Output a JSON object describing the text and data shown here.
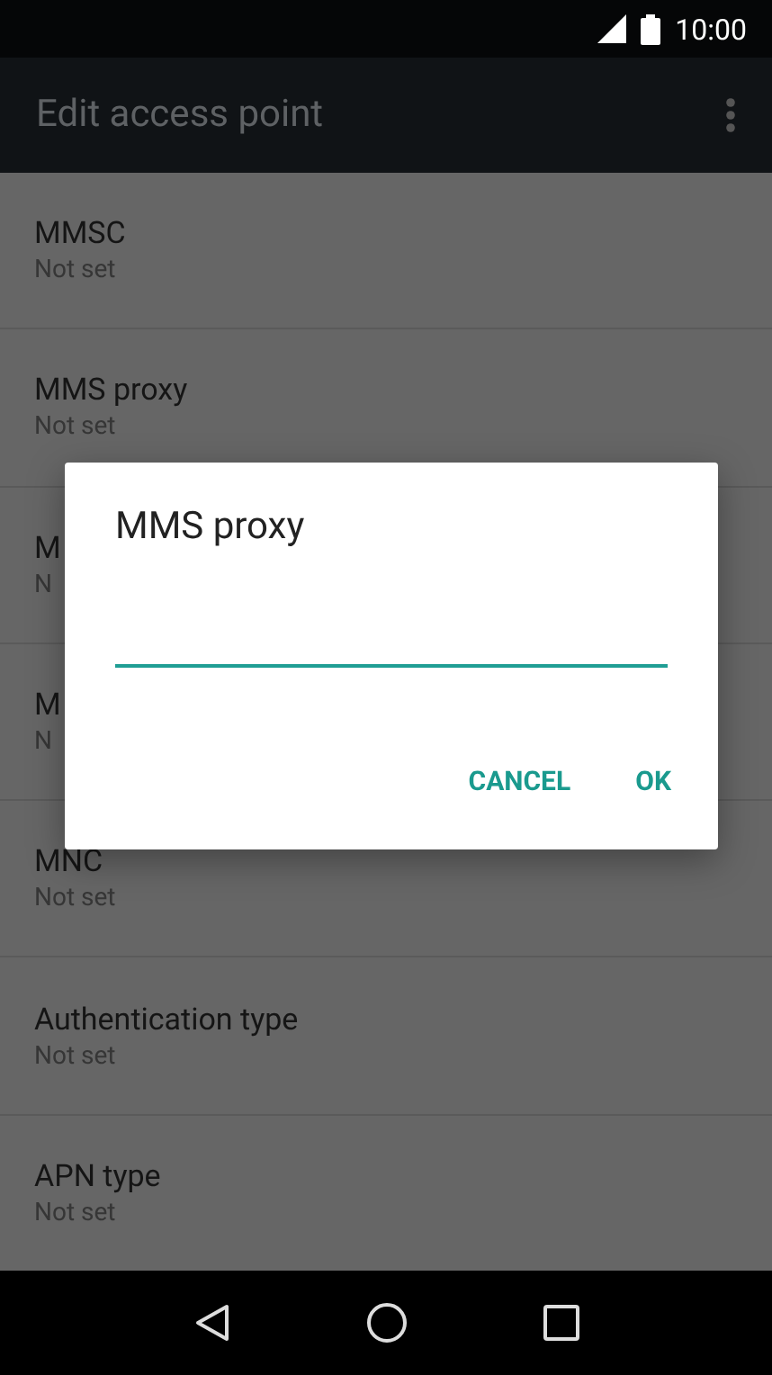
{
  "status_bar": {
    "time": "10:00"
  },
  "app_bar": {
    "title": "Edit access point"
  },
  "settings": [
    {
      "title": "MMSC",
      "summary": "Not set"
    },
    {
      "title": "MMS proxy",
      "summary": "Not set"
    },
    {
      "title": "M",
      "summary": "N"
    },
    {
      "title": "M",
      "summary": "N"
    },
    {
      "title": "MNC",
      "summary": "Not set"
    },
    {
      "title": "Authentication type",
      "summary": "Not set"
    },
    {
      "title": "APN type",
      "summary": "Not set"
    }
  ],
  "dialog": {
    "title": "MMS proxy",
    "buttons": [
      "CANCEL",
      "OK"
    ]
  }
}
